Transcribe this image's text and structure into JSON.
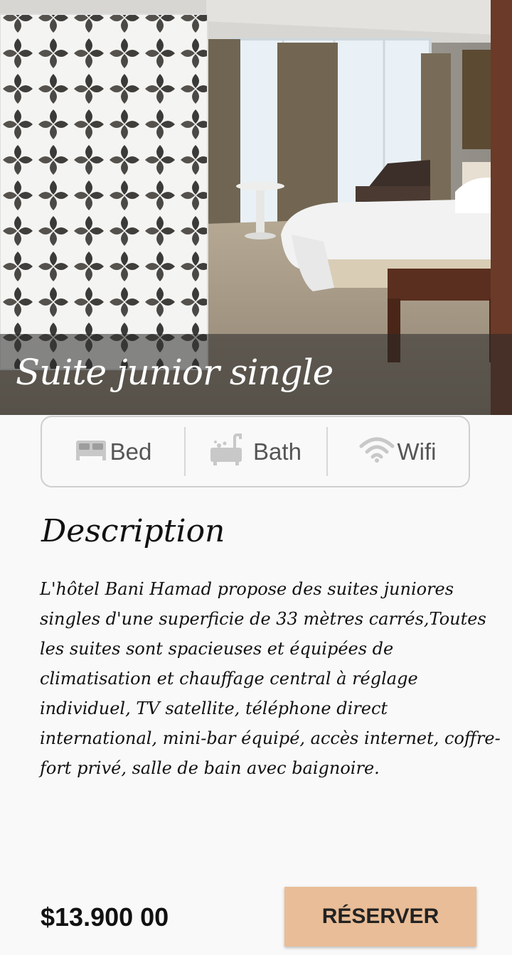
{
  "room": {
    "title": "Suite junior single"
  },
  "amenities": [
    {
      "icon": "bed-icon",
      "label": "Bed"
    },
    {
      "icon": "bathtub-icon",
      "label": "Bath"
    },
    {
      "icon": "wifi-icon",
      "label": "Wifi"
    }
  ],
  "description": {
    "heading": "Description",
    "text": "L'hôtel Bani Hamad propose des suites juniores singles d'une superficie de 33 mètres carrés,Toutes les suites sont spacieuses et équipées de climatisation et chauffage central à réglage individuel, TV satellite, téléphone direct international, mini-bar équipé, accès internet, coffre-fort privé, salle de bain avec baignoire."
  },
  "footer": {
    "price": "$13.900 00",
    "reserve_label": "RÉSERVER"
  },
  "colors": {
    "accent": "#e9bd97",
    "background": "#f9f9f9"
  }
}
